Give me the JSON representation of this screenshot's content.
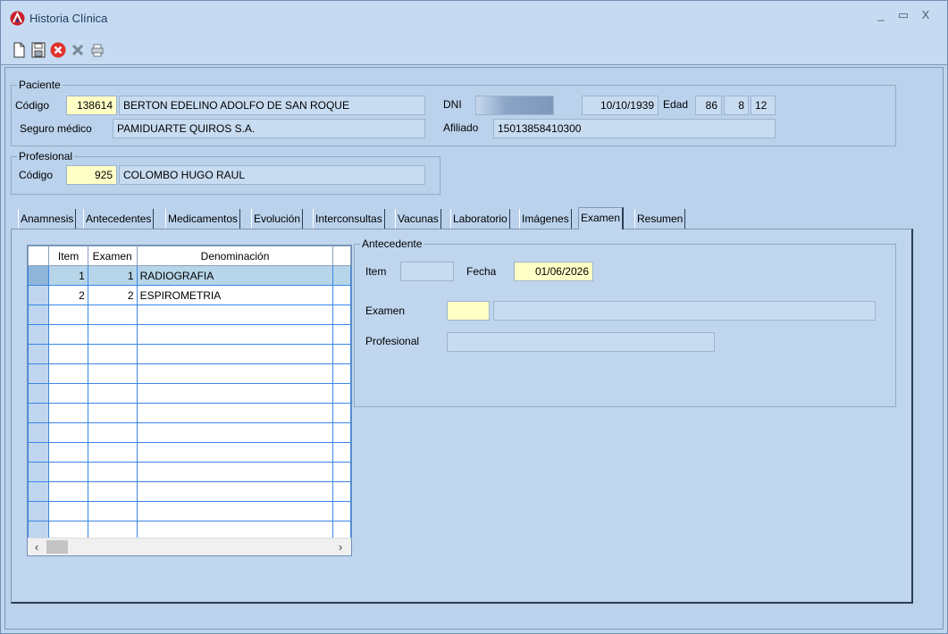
{
  "window": {
    "title": "Historia Clínica",
    "controls": [
      "_",
      "▭",
      "X"
    ]
  },
  "toolbar": {
    "buttons": [
      {
        "name": "new-document-icon",
        "glyph": "🗋"
      },
      {
        "name": "save-icon",
        "glyph": "🖫"
      },
      {
        "name": "cancel-icon",
        "glyph": "✖"
      },
      {
        "name": "delete-icon",
        "glyph": "✕"
      },
      {
        "name": "print-icon",
        "glyph": "⎙"
      }
    ],
    "colors": {
      "cancel": "#e0332e",
      "delete": "#7b8796"
    }
  },
  "paciente": {
    "legend": "Paciente",
    "codigo_label": "Código",
    "codigo": "138614",
    "nombre": "BERTON EDELINO ADOLFO DE SAN ROQUE",
    "dni_label": "DNI",
    "dni": "",
    "fecha_nac": "10/10/1939",
    "edad_label": "Edad",
    "edad_anios": "86",
    "edad_meses": "8",
    "edad_dias": "12",
    "seguro_label": "Seguro médico",
    "seguro": "PAMIDUARTE QUIROS S.A.",
    "afiliado_label": "Afiliado",
    "afiliado": "15013858410300"
  },
  "profesional": {
    "legend": "Profesional",
    "codigo_label": "Código",
    "codigo": "925",
    "nombre": "COLOMBO HUGO RAUL"
  },
  "tabs": [
    "Anamnesis",
    "Antecedentes",
    "Medicamentos",
    "Evolución",
    "Interconsultas",
    "Vacunas",
    "Laboratorio",
    "Imágenes",
    "Examen",
    "Resumen"
  ],
  "active_tab": "Examen",
  "grid": {
    "headers": [
      "Item",
      "Examen",
      "Denominación"
    ],
    "rows": [
      [
        "1",
        "1",
        "RADIOGRAFIA"
      ],
      [
        "2",
        "2",
        "ESPIROMETRIA"
      ]
    ],
    "empty_rows": 12
  },
  "antecedente": {
    "legend": "Antecedente",
    "item_label": "Item",
    "item": "",
    "fecha_label": "Fecha",
    "fecha": "01/06/2026",
    "examen_label": "Examen",
    "examen_codigo": "",
    "examen_desc": "",
    "profesional_label": "Profesional",
    "profesional": ""
  },
  "colors": {
    "window_bg": "#bfd6ee",
    "input_yellow": "#ffffc6",
    "grid_line": "#3a86e8",
    "selected_row": "#b7d5e9"
  }
}
